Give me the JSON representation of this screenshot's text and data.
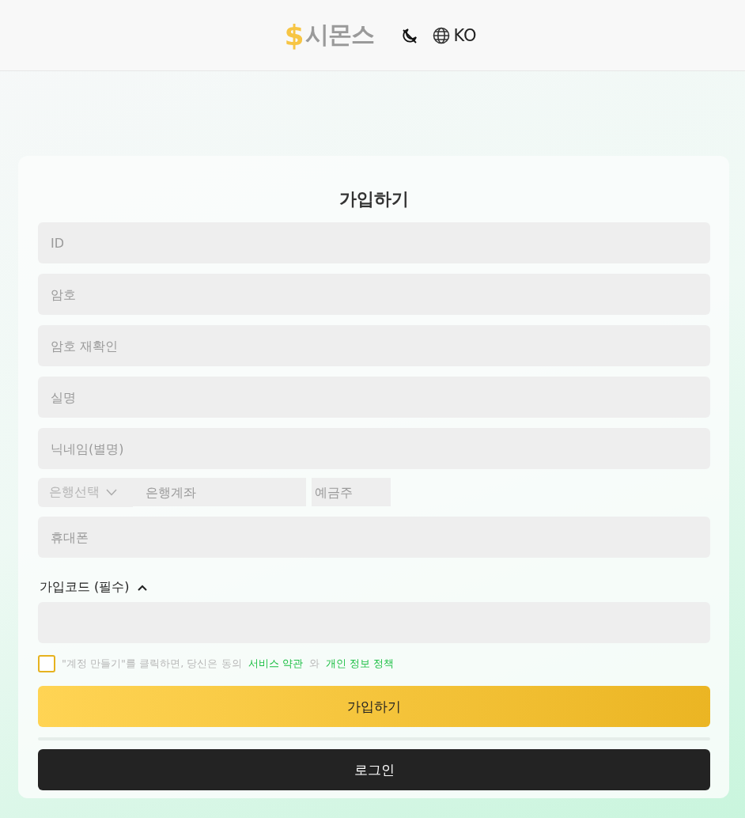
{
  "header": {
    "logo_symbol": "$",
    "logo_text": "시몬스",
    "language": "KO"
  },
  "form": {
    "title": "가입하기",
    "fields": [
      {
        "placeholder": "ID"
      },
      {
        "placeholder": "암호"
      },
      {
        "placeholder": "암호 재확인"
      },
      {
        "placeholder": "실명"
      },
      {
        "placeholder": "닉네임(별명)"
      }
    ],
    "bank": {
      "select_label": "은행선택",
      "account_placeholder": "은행계좌",
      "holder_placeholder": "예금주"
    },
    "phone": {
      "placeholder": "휴대폰"
    },
    "signup_code": {
      "label": "가입코드 (필수)",
      "expanded": true
    },
    "agreement": {
      "checked": false,
      "text": "\"계정 만들기\"를 클릭하면, 당신은 동의",
      "terms_link": "서비스 약관",
      "conjunction": "와",
      "privacy_link": "개인 정보 정책"
    },
    "submit_button": "가입하기",
    "login_button": "로그인"
  }
}
